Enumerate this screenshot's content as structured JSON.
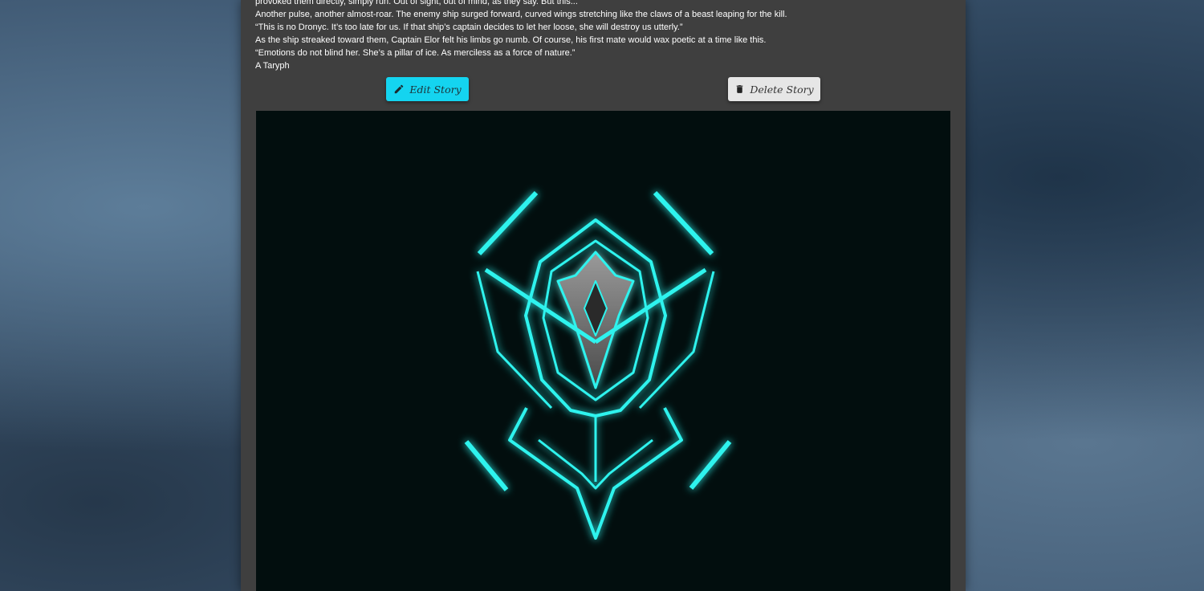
{
  "story": {
    "lines": [
      "provoked them directly, simply run. Out of sight, out of mind, as they say. But this...",
      "Another pulse, another almost-roar. The enemy ship surged forward, curved wings stretching like the claws of a beast leaping for the kill.",
      "“This is no Dronyc. It’s too late for us. If that ship’s captain decides to let her loose, she will destroy us utterly.”",
      "As the ship streaked toward them, Captain Elor felt his limbs go numb. Of course, his first mate would wax poetic at a time like this.",
      "“Emotions do not blind her. She’s a pillar of ice. As merciless as a force of nature.”",
      "A Taryph"
    ]
  },
  "actions": {
    "edit_label": "Edit Story",
    "delete_label": "Delete Story",
    "edit_icon": "pencil-icon",
    "delete_icon": "trash-icon"
  },
  "colors": {
    "accent": "#14d4f0",
    "panel": "#3f3f3f",
    "glow": "#2ff3ee"
  }
}
